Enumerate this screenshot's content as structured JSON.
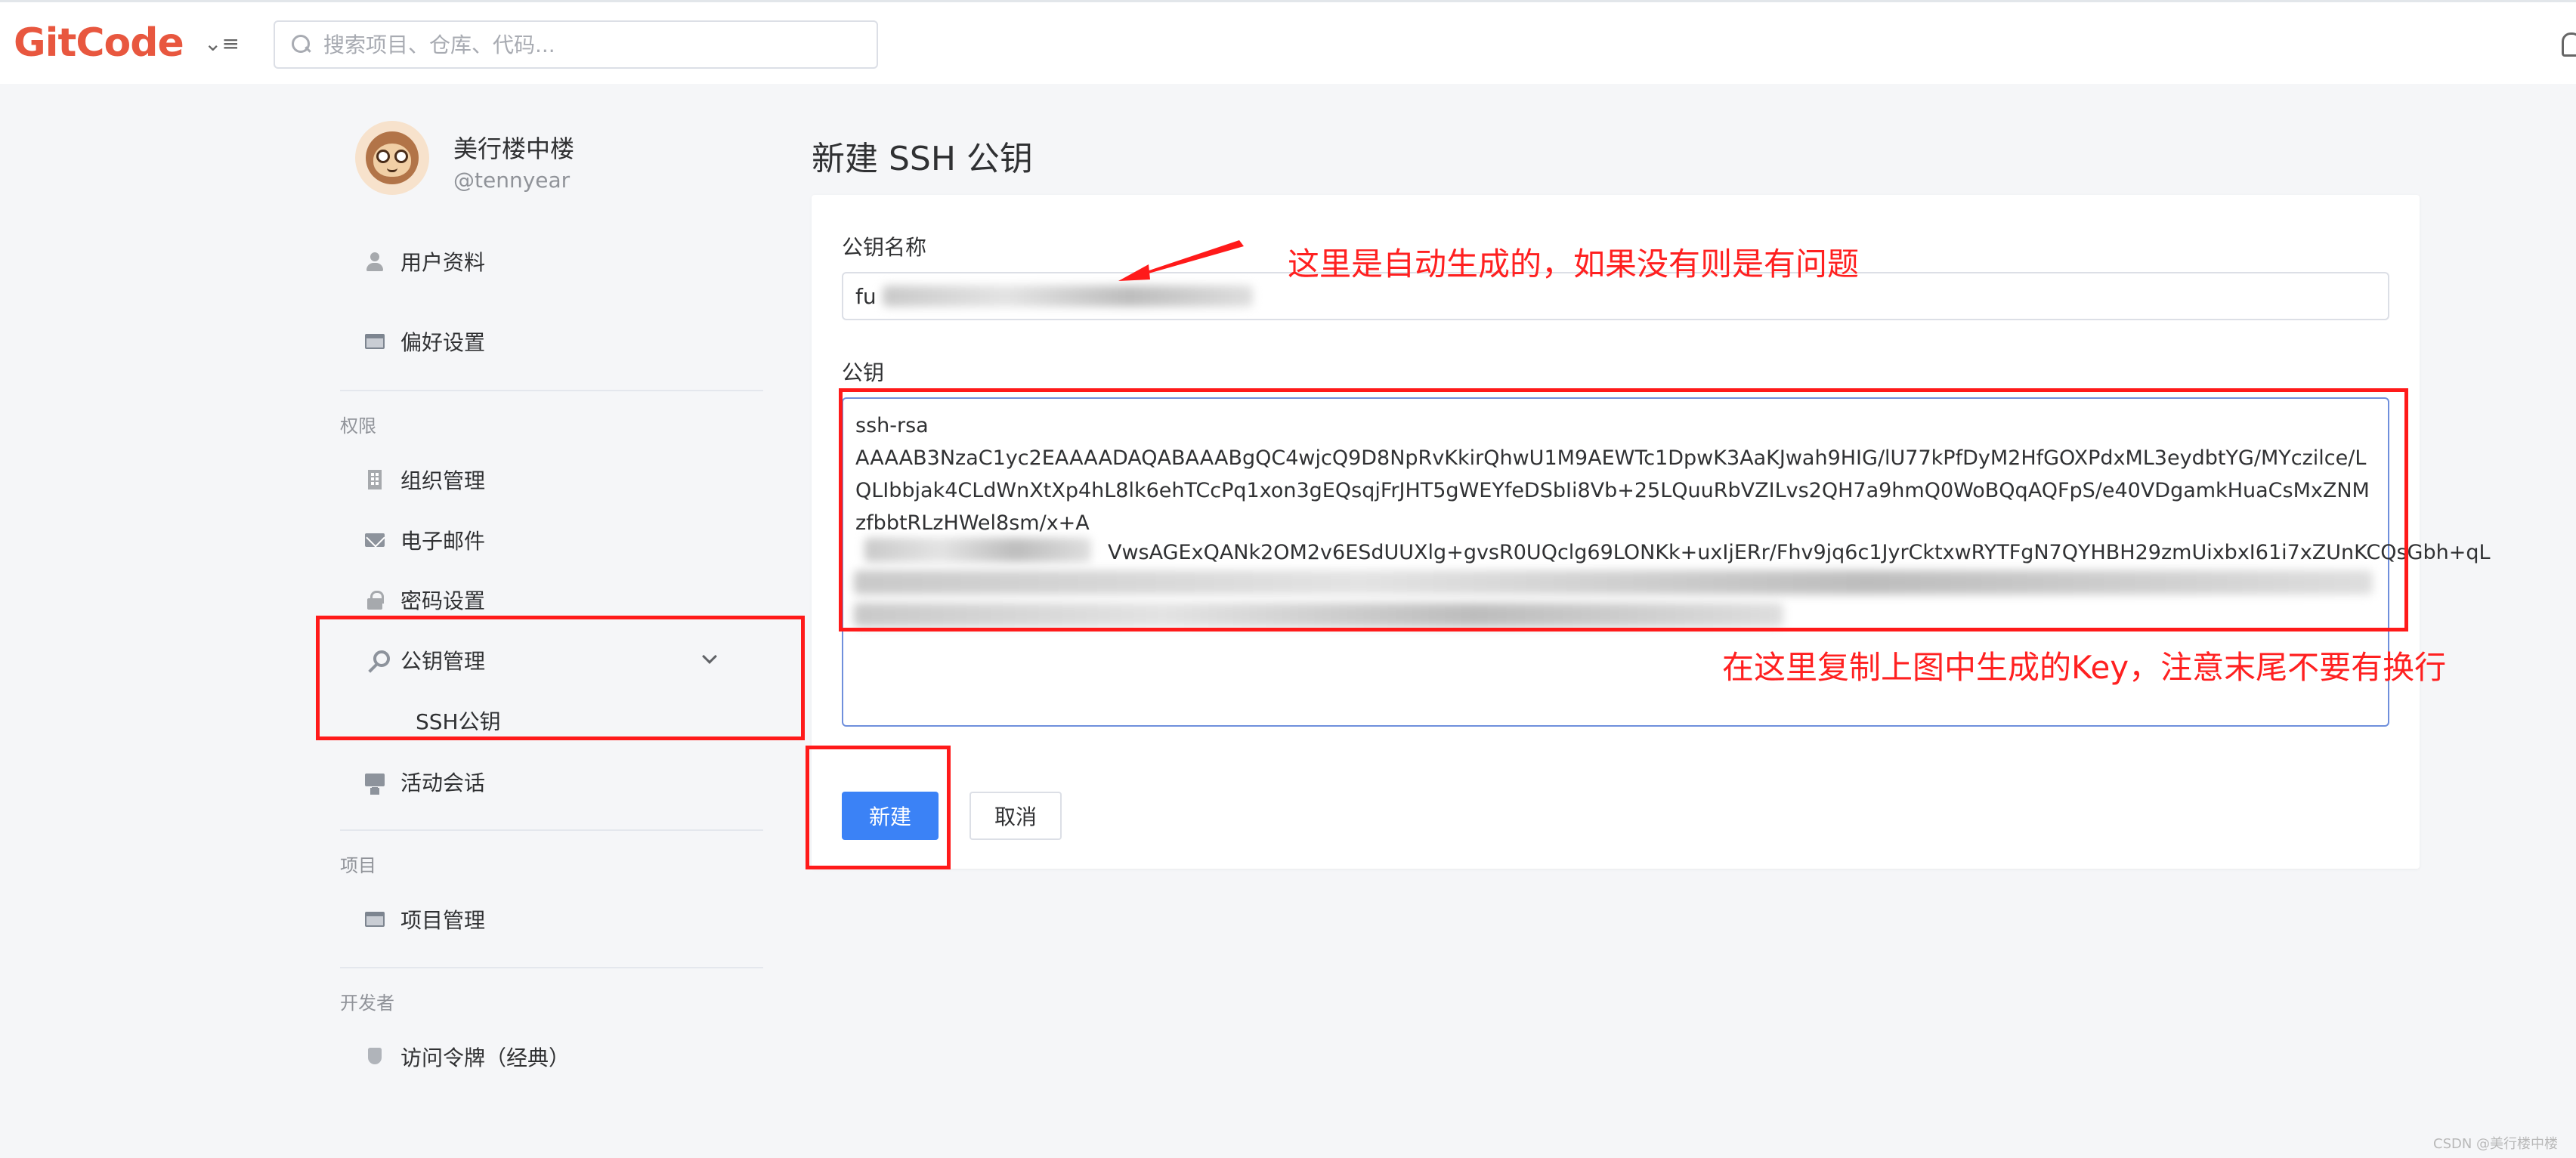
{
  "header": {
    "logo_text": "GitCode",
    "search_placeholder": "搜索项目、仓库、代码..."
  },
  "user": {
    "display_name": "美行楼中楼",
    "handle": "@tennyear"
  },
  "sidebar": {
    "items": [
      {
        "label": "用户资料",
        "icon": "user-icon"
      },
      {
        "label": "偏好设置",
        "icon": "card-icon"
      }
    ],
    "sections": {
      "permissions": "权限",
      "projects": "项目",
      "developer": "开发者"
    },
    "permission_items": [
      {
        "label": "组织管理",
        "icon": "building-icon"
      },
      {
        "label": "电子邮件",
        "icon": "mail-icon"
      },
      {
        "label": "密码设置",
        "icon": "lock-icon"
      },
      {
        "label": "公钥管理",
        "icon": "key-icon",
        "expanded": true
      },
      {
        "label": "活动会话",
        "icon": "monitor-icon"
      }
    ],
    "sub_item": "SSH公钥",
    "project_item": "项目管理",
    "developer_item": "访问令牌（经典）"
  },
  "form": {
    "page_title": "新建 SSH 公钥",
    "name_label": "公钥名称",
    "name_value": "fu",
    "key_label": "公钥",
    "key_value": "ssh-rsa\nAAAAB3NzaC1yc2EAAAADAQABAAABgQC4wjcQ9D8NpRvKkirQhwU1M9AEWTc1DpwK3AaKJwah9HIG/lU77kPfDyM2HfGOXPdxML3eydbtYG/MYczilce/LQLIbbjak4CLdWnXtXp4hL8lk6ehTCcPq1xon3gEQsqjFrJHT5gWEYfeDSbIi8Vb+25LQuuRbVZILvs2QH7a9hmQ0WoBQqAQFpS/e40VDgamkHuaCsMxZNMzfbbtRLzHWel8sm/x+A",
    "key_line3_tail": "VwsAGExQANk2OM2v6ESdUUXlg+gvsR0UQclg69LONKk+uxIjERr/Fhv9jq6c1JyrCktxwRYTFgN7QYHBH29zmUixbxI61i7xZUnKCQsGbh+qL",
    "submit_label": "新建",
    "cancel_label": "取消"
  },
  "annotations": {
    "name_note": "这里是自动生成的，如果没有则是有问题",
    "key_note": "在这里复制上图中生成的Key，注意末尾不要有换行"
  },
  "watermark": "CSDN @美行楼中楼",
  "colors": {
    "brand": "#e8573f",
    "primary": "#3b82f6",
    "annotation": "#ff1a1a"
  }
}
